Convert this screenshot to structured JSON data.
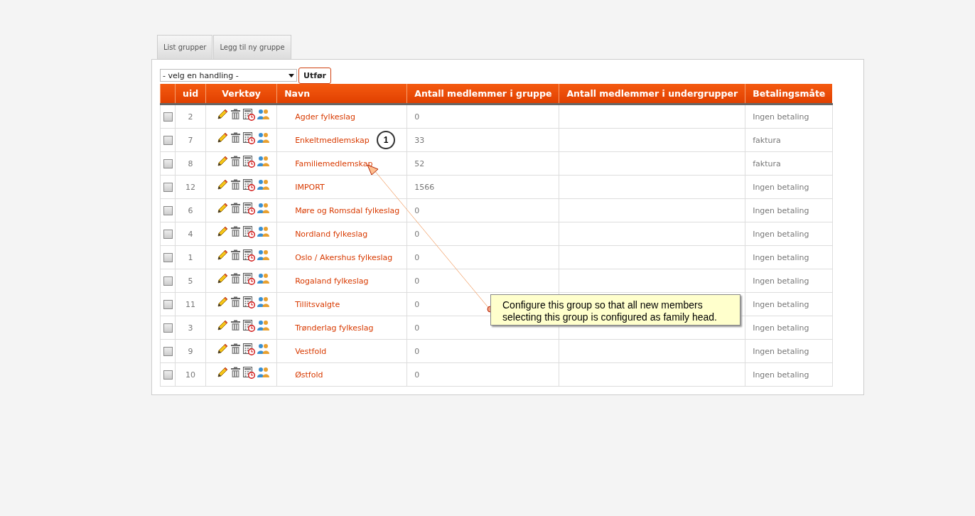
{
  "tabs": [
    {
      "label": "List grupper",
      "selected": false
    },
    {
      "label": "Legg til ny gruppe",
      "selected": false
    }
  ],
  "action_select": {
    "value": "- velg en handling -"
  },
  "action_button": "Utfør",
  "table": {
    "columns": [
      "",
      "uid",
      "Verktøy",
      "Navn",
      "Antall medlemmer i gruppe",
      "Antall medlemmer i undergrupper",
      "Betalingsmåte"
    ],
    "rows": [
      {
        "checked": false,
        "uid": "2",
        "name": "Agder fylkeslag",
        "members": "0",
        "payment": "Ingen betaling"
      },
      {
        "checked": false,
        "uid": "7",
        "name": "Enkeltmedlemskap",
        "members": "33",
        "payment": "faktura"
      },
      {
        "checked": false,
        "uid": "8",
        "name": "Familiemedlemskap",
        "members": "52",
        "payment": "faktura"
      },
      {
        "checked": false,
        "uid": "12",
        "name": "IMPORT",
        "members": "1566",
        "payment": "Ingen betaling"
      },
      {
        "checked": false,
        "uid": "6",
        "name": "Møre og Romsdal fylkeslag",
        "members": "0",
        "payment": "Ingen betaling"
      },
      {
        "checked": false,
        "uid": "4",
        "name": "Nordland fylkeslag",
        "members": "0",
        "payment": "Ingen betaling"
      },
      {
        "checked": false,
        "uid": "1",
        "name": "Oslo / Akershus fylkeslag",
        "members": "0",
        "payment": "Ingen betaling"
      },
      {
        "checked": false,
        "uid": "5",
        "name": "Rogaland fylkeslag",
        "members": "0",
        "payment": "Ingen betaling"
      },
      {
        "checked": false,
        "uid": "11",
        "name": "Tillitsvalgte",
        "members": "0",
        "payment": "Ingen betaling"
      },
      {
        "checked": false,
        "uid": "3",
        "name": "Trønderlag fylkeslag",
        "members": "0",
        "payment": "Ingen betaling"
      },
      {
        "checked": false,
        "uid": "9",
        "name": "Vestfold",
        "members": "0",
        "payment": "Ingen betaling"
      },
      {
        "checked": false,
        "uid": "10",
        "name": "Østfold",
        "members": "0",
        "payment": "Ingen betaling"
      }
    ]
  },
  "annotation": {
    "marker": "1",
    "callout": "Configure this group so that all new members selecting this group is configured as family head."
  }
}
